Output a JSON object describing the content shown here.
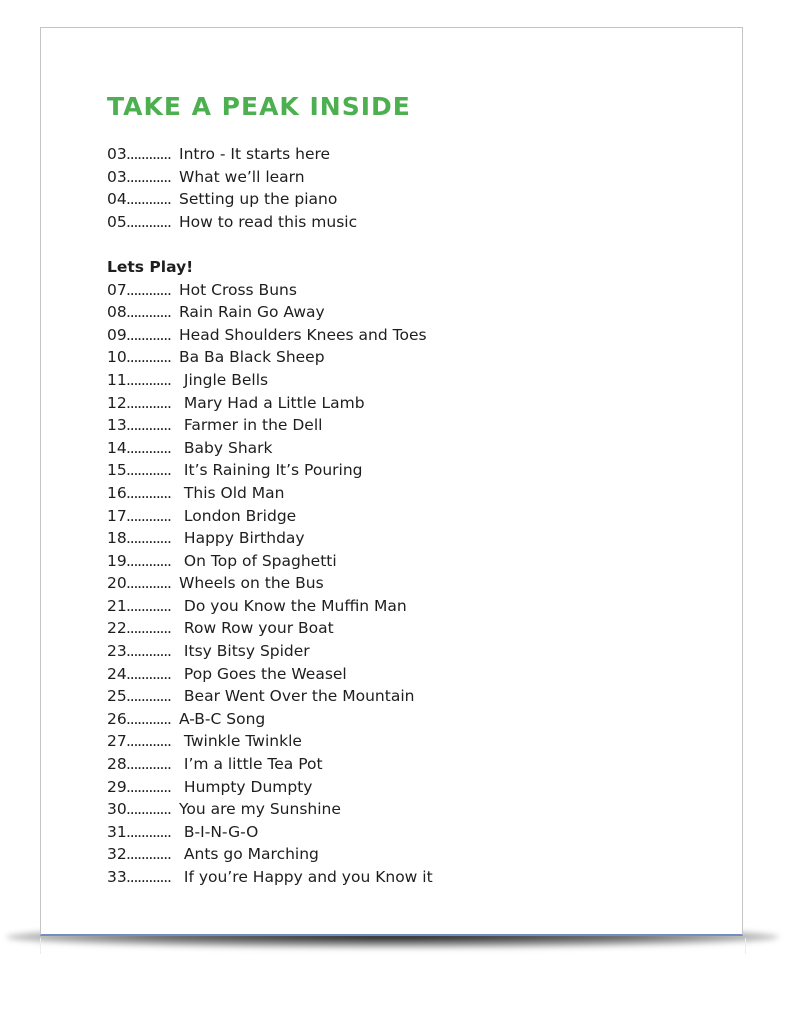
{
  "document": {
    "title": "TAKE A PEAK INSIDE",
    "colors": {
      "title": "#4caf50",
      "text": "#1e1e1e",
      "page_border": "#c4c4c4",
      "page_bottom_edge": "#6f8fc4"
    },
    "leader": "............",
    "intro_entries": [
      {
        "page": "03",
        "title": "Intro - It starts here"
      },
      {
        "page": "03",
        "title": "What we’ll learn"
      },
      {
        "page": "04",
        "title": "Setting up the piano"
      },
      {
        "page": "05",
        "title": "How to read this music"
      }
    ],
    "section_heading": "Lets Play!",
    "song_entries": [
      {
        "page": "07",
        "title": "Hot Cross Buns"
      },
      {
        "page": "08",
        "title": "Rain Rain Go Away"
      },
      {
        "page": "09",
        "title": "Head Shoulders Knees and Toes"
      },
      {
        "page": "10",
        "title": "Ba Ba Black Sheep"
      },
      {
        "page": "11",
        "title": " Jingle Bells"
      },
      {
        "page": "12",
        "title": " Mary Had a Little Lamb"
      },
      {
        "page": "13",
        "title": " Farmer in the Dell"
      },
      {
        "page": "14",
        "title": " Baby Shark"
      },
      {
        "page": "15",
        "title": " It’s Raining It’s Pouring"
      },
      {
        "page": "16",
        "title": " This Old Man"
      },
      {
        "page": "17",
        "title": " London Bridge"
      },
      {
        "page": "18",
        "title": " Happy Birthday"
      },
      {
        "page": "19",
        "title": " On Top of Spaghetti"
      },
      {
        "page": "20",
        "title": "Wheels on the Bus"
      },
      {
        "page": "21",
        "title": " Do you Know the Muffin Man"
      },
      {
        "page": "22",
        "title": " Row Row your Boat"
      },
      {
        "page": "23",
        "title": " Itsy Bitsy Spider"
      },
      {
        "page": "24",
        "title": " Pop Goes the Weasel"
      },
      {
        "page": "25",
        "title": " Bear Went Over the Mountain"
      },
      {
        "page": "26",
        "title": "A-B-C Song"
      },
      {
        "page": "27",
        "title": " Twinkle Twinkle"
      },
      {
        "page": "28",
        "title": " I’m a little Tea Pot"
      },
      {
        "page": "29",
        "title": " Humpty Dumpty"
      },
      {
        "page": "30",
        "title": "You are my Sunshine"
      },
      {
        "page": "31",
        "title": " B-I-N-G-O"
      },
      {
        "page": "32",
        "title": " Ants go Marching"
      },
      {
        "page": "33",
        "title": " If you’re Happy and you Know it"
      }
    ]
  }
}
